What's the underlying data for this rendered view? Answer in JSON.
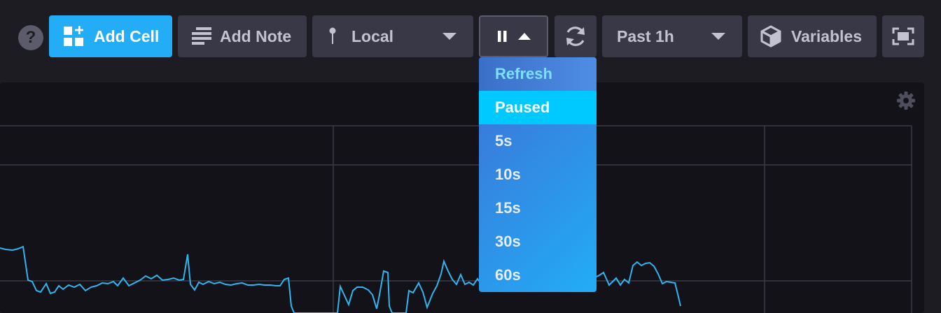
{
  "toolbar": {
    "help_glyph": "?",
    "add_cell_label": "Add Cell",
    "add_note_label": "Add Note",
    "source_label": "Local",
    "time_range_label": "Past 1h",
    "variables_label": "Variables"
  },
  "autorefresh_dropdown": {
    "header": "Refresh",
    "selected": "Paused",
    "options": [
      "Paused",
      "5s",
      "10s",
      "15s",
      "30s",
      "60s"
    ]
  },
  "colors": {
    "accent": "#22adf6",
    "dropdown_active": "#00c9ff",
    "series": "#2fb6f0"
  },
  "icons": [
    "help-icon",
    "add-cell-icon",
    "add-note-icon",
    "pin-icon",
    "pause-icon",
    "refresh-icon",
    "cube-icon",
    "fullscreen-icon",
    "gear-icon"
  ]
}
